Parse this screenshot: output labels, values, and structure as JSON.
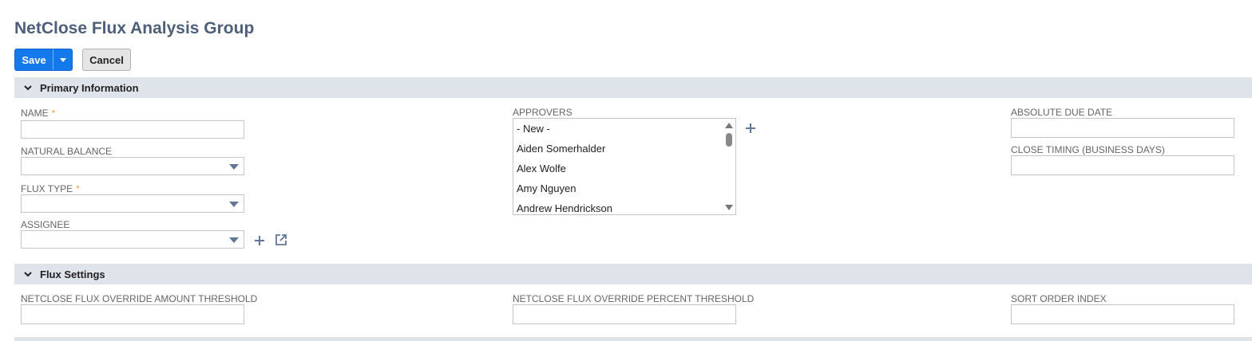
{
  "page": {
    "title": "NetClose Flux Analysis Group"
  },
  "toolbar": {
    "save_label": "Save",
    "cancel_label": "Cancel"
  },
  "sections": {
    "primary": {
      "title": "Primary Information"
    },
    "flux": {
      "title": "Flux Settings"
    }
  },
  "fields": {
    "name": {
      "label": "NAME",
      "required_mark": "*",
      "value": ""
    },
    "natural_balance": {
      "label": "NATURAL BALANCE",
      "value": ""
    },
    "flux_type": {
      "label": "FLUX TYPE",
      "required_mark": "*",
      "value": ""
    },
    "assignee": {
      "label": "ASSIGNEE",
      "value": ""
    },
    "approvers": {
      "label": "APPROVERS",
      "options": [
        "- New -",
        "Aiden Somerhalder",
        "Alex Wolfe",
        "Amy Nguyen",
        "Andrew Hendrickson"
      ]
    },
    "absolute_due_date": {
      "label": "ABSOLUTE DUE DATE",
      "value": ""
    },
    "close_timing": {
      "label": "CLOSE TIMING (BUSINESS DAYS)",
      "value": ""
    },
    "amount_threshold": {
      "label": "NETCLOSE FLUX OVERRIDE AMOUNT THRESHOLD",
      "value": ""
    },
    "percent_threshold": {
      "label": "NETCLOSE FLUX OVERRIDE PERCENT THRESHOLD",
      "value": ""
    },
    "sort_order": {
      "label": "SORT ORDER INDEX",
      "value": ""
    }
  },
  "icons": {
    "add": "plus-icon",
    "open": "external-link-icon",
    "collapse": "chevron-down-icon",
    "dropdown": "caret-down-icon"
  },
  "colors": {
    "primary_button": "#1479eb",
    "title": "#4d5f79",
    "section_bar": "#dfe4eb",
    "required": "#e8a040",
    "icon": "#607799"
  }
}
